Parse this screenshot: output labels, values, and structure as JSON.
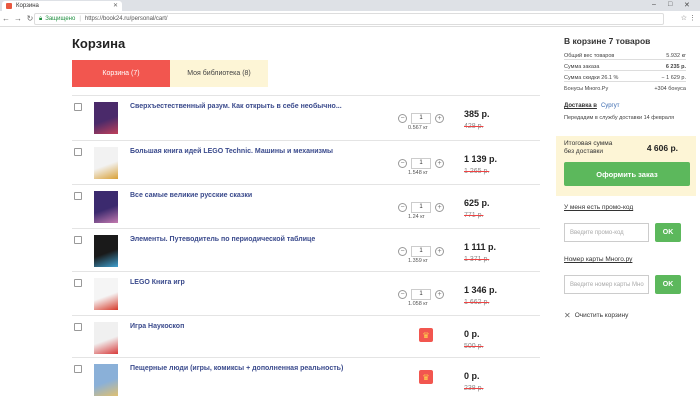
{
  "browser": {
    "tab_title": "Корзина",
    "secure_label": "Защищено",
    "url": "https://book24.ru/personal/cart/"
  },
  "page": {
    "title": "Корзина",
    "tabs": [
      {
        "label": "Корзина (7)",
        "active": true
      },
      {
        "label": "Моя библиотека (8)",
        "active": false
      }
    ]
  },
  "items": [
    {
      "name": "Сверхъестественный разум. Как открыть в себе необычно...",
      "qty": "1",
      "weight": "0.567 кг",
      "price": "385 р.",
      "old_price": "428 р.",
      "gift": false,
      "cover_colors": [
        "#4a2a6a",
        "#c0405a"
      ]
    },
    {
      "name": "Большая книга идей LEGO Technic. Машины и механизмы",
      "qty": "1",
      "weight": "1.548 кг",
      "price": "1 139 р.",
      "old_price": "1 265 р.",
      "gift": false,
      "cover_colors": [
        "#f2f2f2",
        "#d9a035"
      ]
    },
    {
      "name": "Все самые великие русские сказки",
      "qty": "1",
      "weight": "1.24 кг",
      "price": "625 р.",
      "old_price": "771 р.",
      "gift": false,
      "cover_colors": [
        "#3b2a6e",
        "#c47ab0"
      ]
    },
    {
      "name": "Элементы. Путеводитель по периодической таблице",
      "qty": "1",
      "weight": "1.359 кг",
      "price": "1 111 р.",
      "old_price": "1 371 р.",
      "gift": false,
      "cover_colors": [
        "#1a1a1a",
        "#3fa0d0"
      ]
    },
    {
      "name": "LEGO Книга игр",
      "qty": "1",
      "weight": "1.058 кг",
      "price": "1 346 р.",
      "old_price": "1 662 р.",
      "gift": false,
      "cover_colors": [
        "#f5f5f5",
        "#d63a2a"
      ]
    },
    {
      "name": "Игра Наукоскоп",
      "qty": "",
      "weight": "",
      "price": "0 р.",
      "old_price": "500 р.",
      "gift": true,
      "cover_colors": [
        "#f0f0f0",
        "#d83a3a"
      ]
    },
    {
      "name": "Пещерные люди (игры, комиксы + дополненная реальность)",
      "qty": "",
      "weight": "",
      "price": "0 р.",
      "old_price": "238 р.",
      "gift": true,
      "cover_colors": [
        "#8ab0d8",
        "#e0c070"
      ]
    }
  ],
  "sidebar": {
    "title": "В корзине 7 товаров",
    "rows": [
      {
        "label": "Общий вес товаров",
        "value": "5.932 кг"
      },
      {
        "label": "Сумма заказа",
        "value": "6 235 р."
      },
      {
        "label": "Сумма скидки 26.1 %",
        "value": "− 1 629 р."
      },
      {
        "label": "Бонусы Много.Ру",
        "value": "+304 бонуса"
      }
    ],
    "delivery_label": "Доставка в",
    "delivery_city": "Сургут",
    "delivery_note": "Передадим в службу доставки 14 февраля",
    "total_label": "Итоговая сумма без доставки",
    "total_value": "4 606 р.",
    "order_button": "Оформить заказ",
    "promo_link": "У меня есть промо-код",
    "promo_placeholder": "Введите промо-код",
    "ok_label": "OK",
    "card_link": "Номер карты Много.ру",
    "card_placeholder": "Введите номер карты Мно",
    "clear_label": "Очистить корзину"
  },
  "colors": {
    "accent_red": "#f2564f",
    "accent_green": "#5cb85c",
    "tab_inactive_bg": "#fdf5d6",
    "link_blue": "#3a4a8c"
  }
}
